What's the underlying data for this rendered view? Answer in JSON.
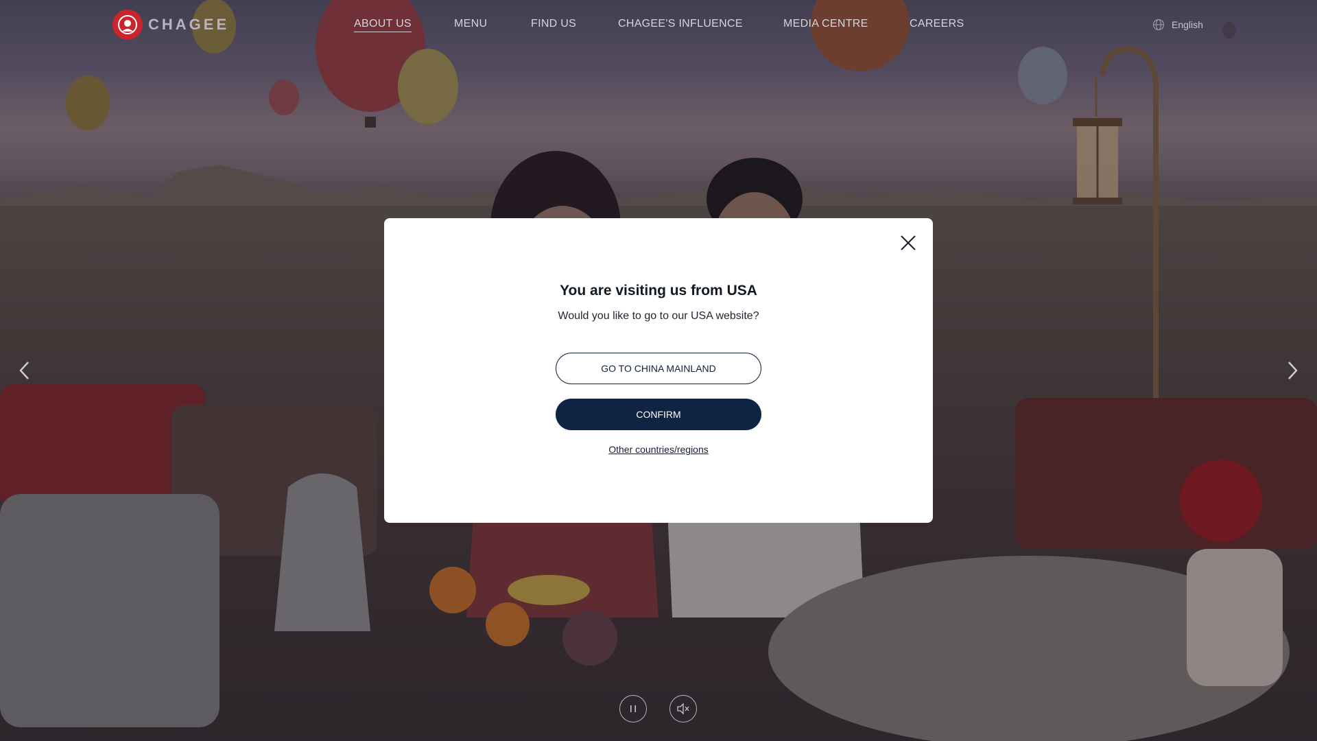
{
  "brand": {
    "name": "CHAGEE",
    "logo_color": "#c8252d"
  },
  "nav": {
    "items": [
      {
        "label": "ABOUT US"
      },
      {
        "label": "MENU"
      },
      {
        "label": "FIND US"
      },
      {
        "label": "CHAGEE'S INFLUENCE"
      },
      {
        "label": "MEDIA CENTRE"
      },
      {
        "label": "CAREERS"
      }
    ]
  },
  "language": {
    "icon": "globe-icon",
    "label": "English"
  },
  "carousel": {
    "prev_icon": "chevron-left-icon",
    "next_icon": "chevron-right-icon"
  },
  "media": {
    "pause_icon": "pause-icon",
    "mute_icon": "speaker-muted-icon"
  },
  "modal": {
    "title": "You are visiting us from USA",
    "subtitle": "Would you like to go to our USA website?",
    "secondary_button": "GO TO CHINA MAINLAND",
    "primary_button": "CONFIRM",
    "other_link": "Other countries/regions",
    "accent": "#0f2443"
  }
}
